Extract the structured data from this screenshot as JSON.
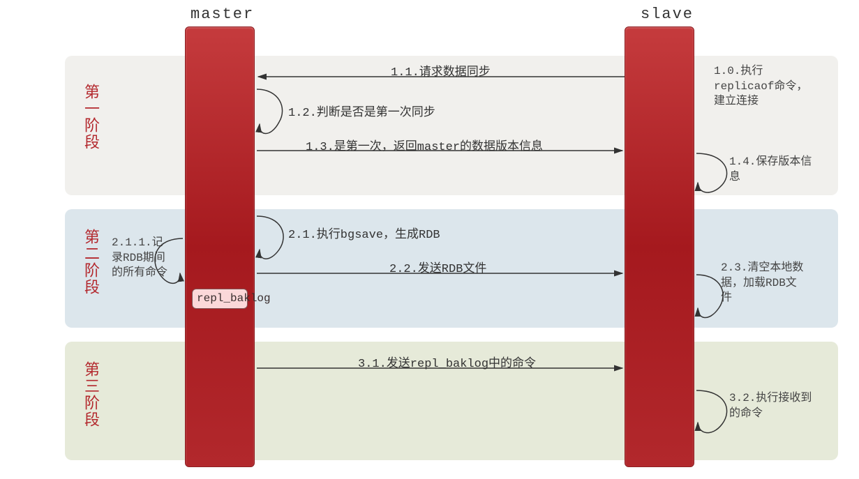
{
  "headers": {
    "master": "master",
    "slave": "slave"
  },
  "phases": {
    "p1": "第一阶段",
    "p2": "第二阶段",
    "p3": "第三阶段"
  },
  "messages": {
    "m11": "1.1.请求数据同步",
    "m12": "1.2.判断是否是第一次同步",
    "m13": "1.3.是第一次，返回master的数据版本信息",
    "m21": "2.1.执行bgsave，生成RDB",
    "m22": "2.2.发送RDB文件",
    "m31": "3.1.发送repl_baklog中的命令"
  },
  "sideNotes": {
    "s10": "1.0.执行replicaof命令，建立连接",
    "s14": "1.4.保存版本信息",
    "s211": "2.1.1.记录RDB期间的所有命令",
    "s23": "2.3.清空本地数据，加载RDB文件",
    "s32": "3.2.执行接收到的命令"
  },
  "replBox": "repl_baklog"
}
